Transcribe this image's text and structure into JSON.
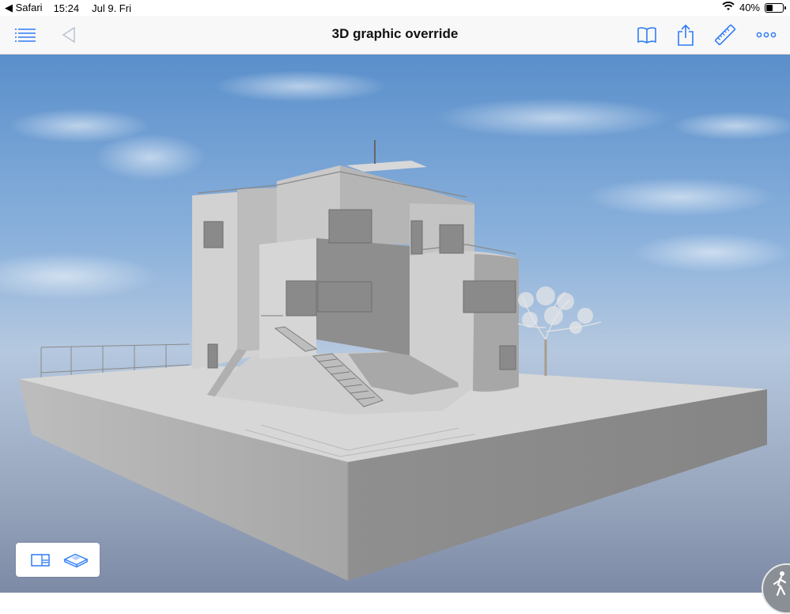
{
  "status_bar": {
    "back_app": "◀ Safari",
    "time": "15:24",
    "date": "Jul 9. Fri",
    "battery_percent": "40%",
    "battery_level": 0.4
  },
  "nav": {
    "title": "3D graphic override",
    "left_icons": [
      "list-icon",
      "back-arrow-icon"
    ],
    "right_icons": [
      "book-icon",
      "share-icon",
      "ruler-icon",
      "more-icon"
    ],
    "accent_color": "#2f7cf6"
  },
  "view_toggle": {
    "icons": [
      "2d-plan-icon",
      "3d-view-icon"
    ]
  },
  "walk_button": {
    "icon": "walking-person-icon"
  }
}
